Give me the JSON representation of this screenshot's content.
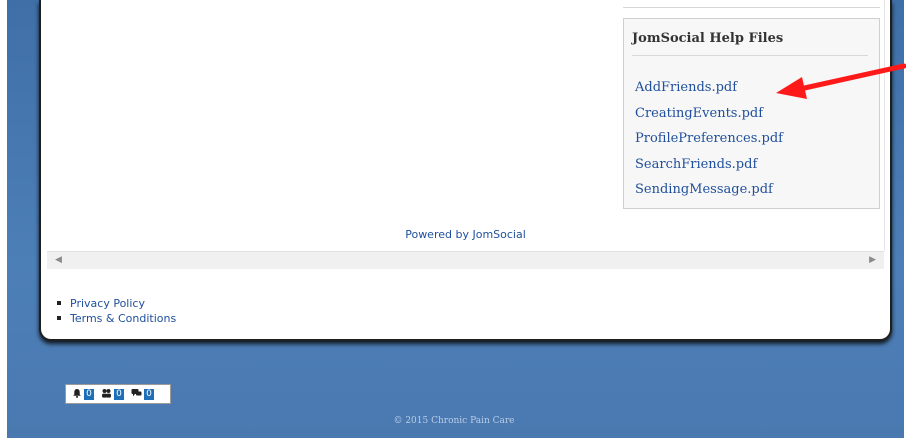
{
  "help_module": {
    "title": "JomSocial Help Files",
    "files": [
      {
        "label": "AddFriends.pdf"
      },
      {
        "label": "CreatingEvents.pdf"
      },
      {
        "label": "ProfilePreferences.pdf"
      },
      {
        "label": "SearchFriends.pdf"
      },
      {
        "label": "SendingMessage.pdf"
      }
    ]
  },
  "powered_by": "Powered by JomSocial",
  "scrollbar": {
    "left_arrow": "◀",
    "right_arrow": "▶"
  },
  "footer": {
    "links": [
      {
        "label": "Privacy Policy"
      },
      {
        "label": "Terms & Conditions"
      }
    ],
    "copyright": "© 2015 Chronic Pain Care"
  },
  "toolbar": {
    "notifications": {
      "icon": "bell-icon",
      "count": "0"
    },
    "friend_requests": {
      "icon": "users-icon",
      "count": "0"
    },
    "messages": {
      "icon": "chat-icon",
      "count": "0"
    }
  },
  "annotation": {
    "arrow_color": "#ff1a1a"
  },
  "colors": {
    "background": "#4d7fb7",
    "link": "#1f4f9c",
    "badge": "#1f6fb8"
  }
}
